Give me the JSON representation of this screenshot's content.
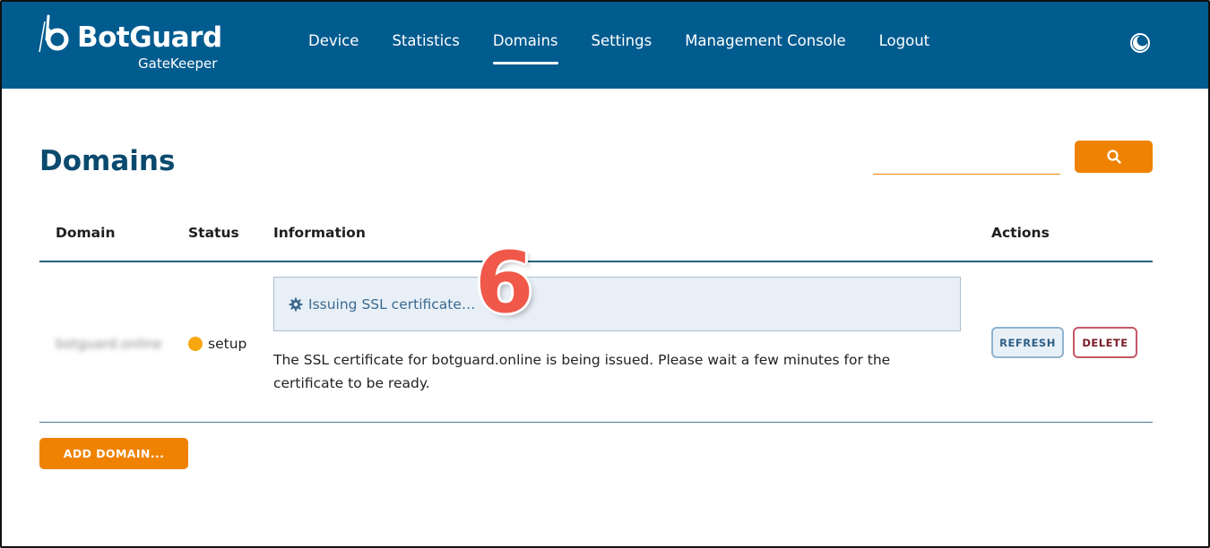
{
  "brand": {
    "name": "BotGuard",
    "product": "GateKeeper"
  },
  "nav": {
    "items": [
      {
        "label": "Device",
        "active": false
      },
      {
        "label": "Statistics",
        "active": false
      },
      {
        "label": "Domains",
        "active": true
      },
      {
        "label": "Settings",
        "active": false
      },
      {
        "label": "Management Console",
        "active": false
      },
      {
        "label": "Logout",
        "active": false
      }
    ],
    "theme_toggle_icon": "theme-toggle-icon"
  },
  "page": {
    "title": "Domains",
    "search": {
      "value": "",
      "placeholder": "",
      "button_icon": "search-icon"
    }
  },
  "table": {
    "columns": [
      "Domain",
      "Status",
      "Information",
      "Actions"
    ],
    "rows": [
      {
        "domain": "botguard.online",
        "status": "setup",
        "status_color": "#f7a70f",
        "info_banner": "Issuing SSL certificate…",
        "info_banner_icon": "gear-icon",
        "info_text": "The SSL certificate for botguard.online is being issued. Please wait a few minutes for the certificate to be ready.",
        "actions": {
          "refresh": "REFRESH",
          "delete": "DELETE"
        }
      }
    ]
  },
  "add_domain_label": "ADD DOMAIN...",
  "annotation": {
    "step": "6"
  },
  "colors": {
    "header_bg": "#005b8f",
    "accent": "#ef8200",
    "title": "#0a4a6e",
    "status_setup": "#f7a70f",
    "annotation": "#f0584a"
  }
}
